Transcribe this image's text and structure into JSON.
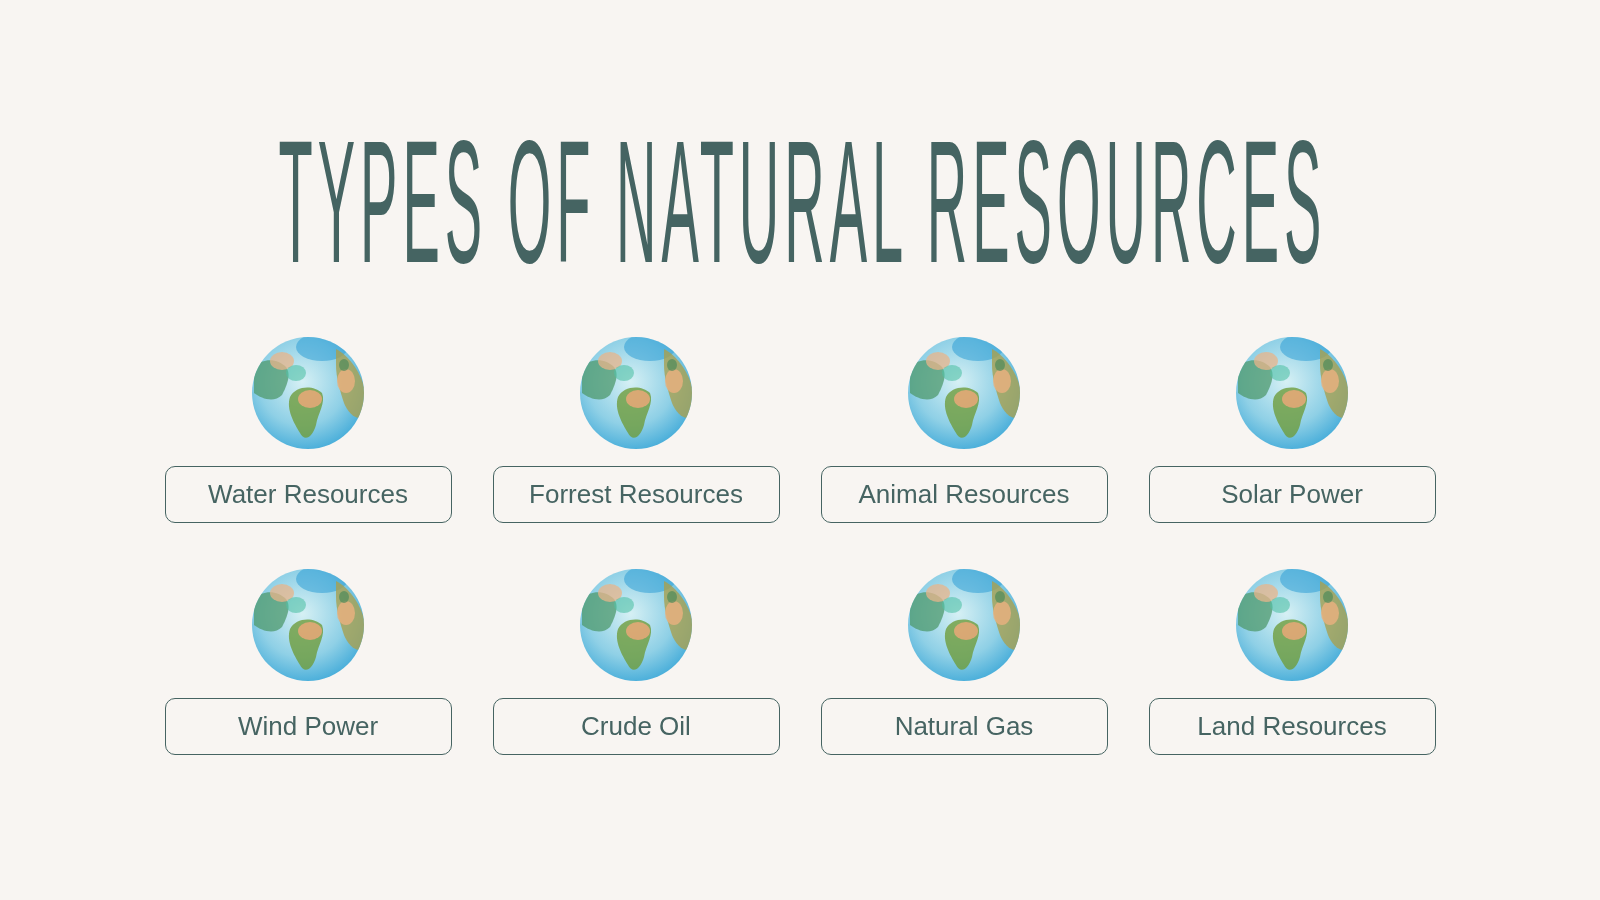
{
  "title": "TYPES OF NATURAL RESOURCES",
  "resources": [
    {
      "label": "Water Resources"
    },
    {
      "label": "Forrest Resources"
    },
    {
      "label": "Animal Resources"
    },
    {
      "label": "Solar Power"
    },
    {
      "label": "Wind Power"
    },
    {
      "label": "Crude Oil"
    },
    {
      "label": "Natural Gas"
    },
    {
      "label": "Land Resources"
    }
  ]
}
